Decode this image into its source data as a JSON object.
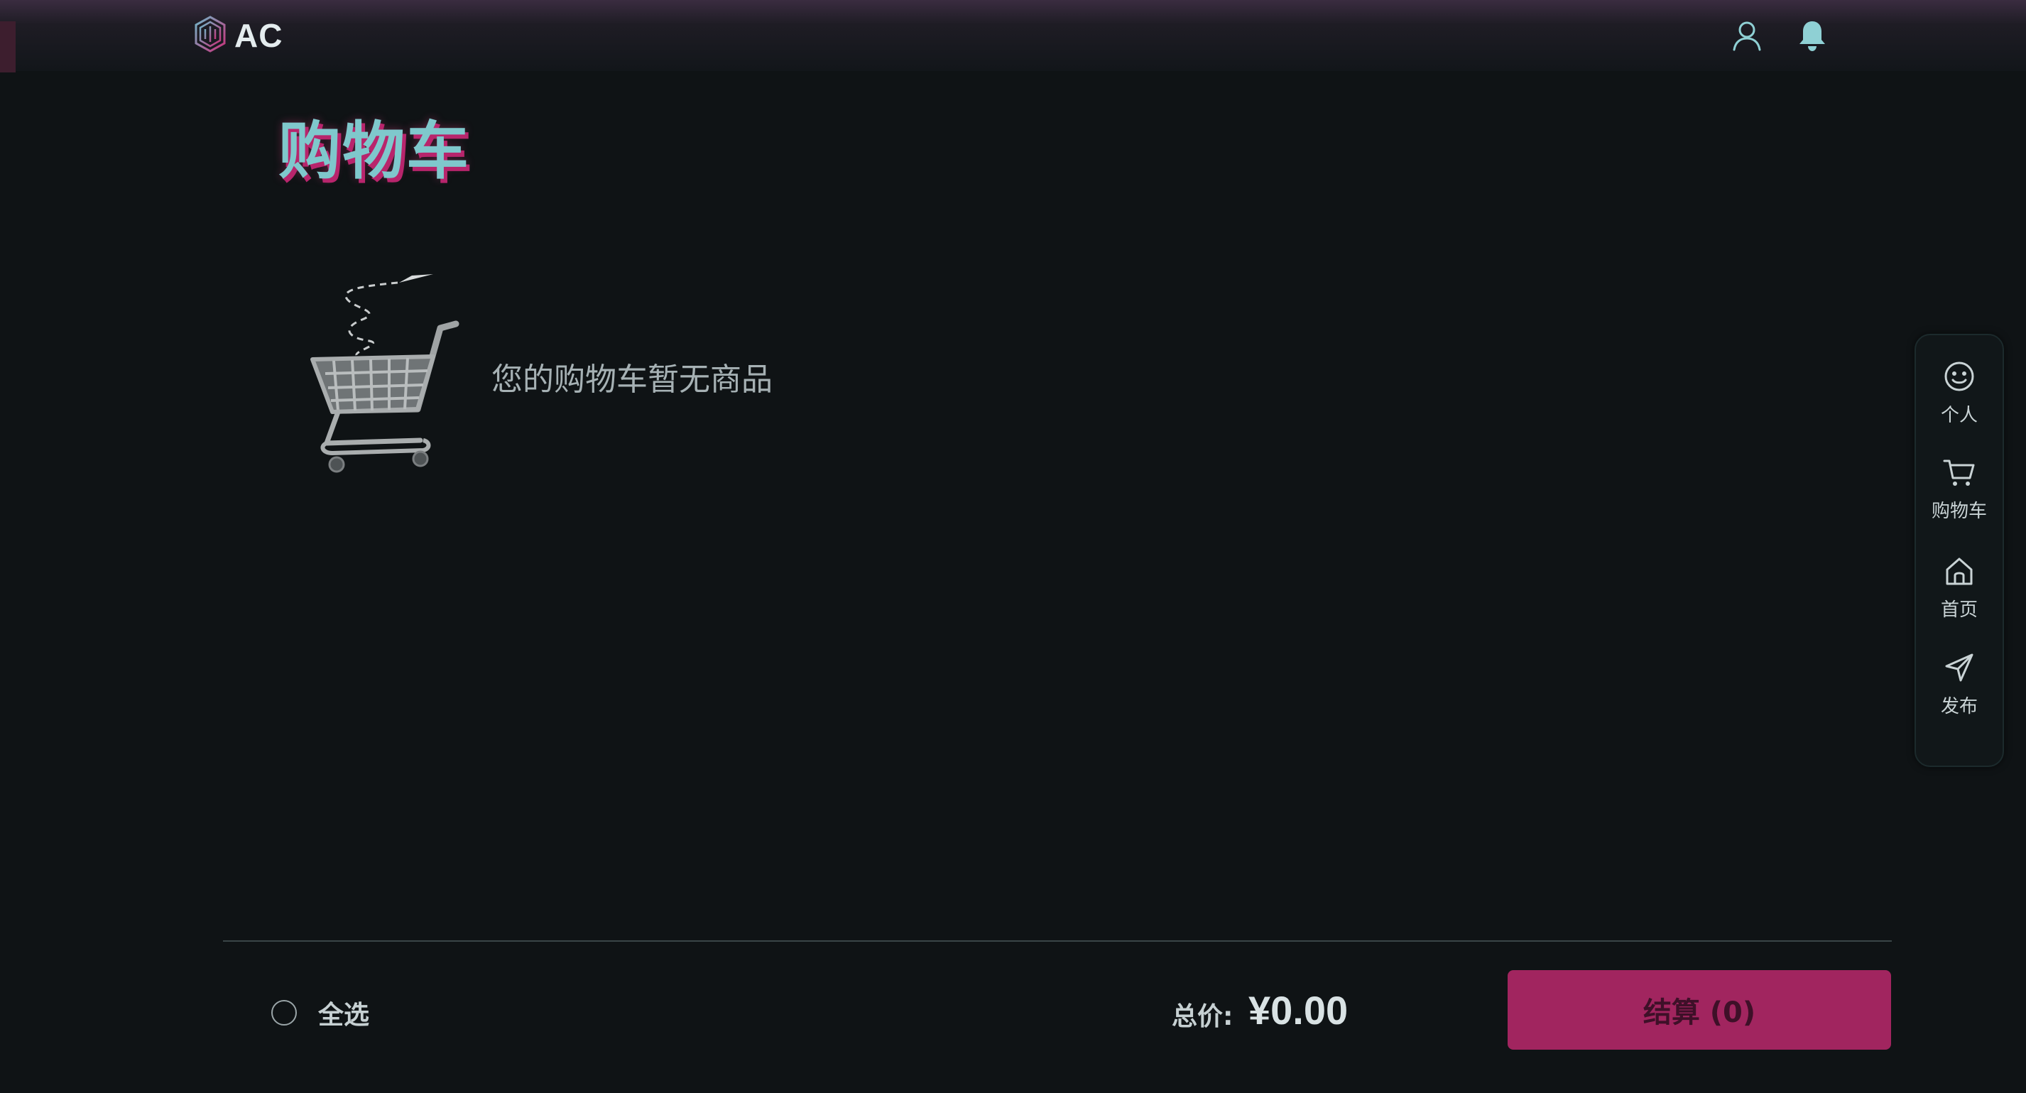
{
  "header": {
    "logo_text": "AC",
    "profile_icon": "user-icon",
    "notification_icon": "bell-icon"
  },
  "page": {
    "title": "购物车",
    "empty_message": "您的购物车暂无商品"
  },
  "sidenav": {
    "items": [
      {
        "label": "个人",
        "icon": "smiley-icon"
      },
      {
        "label": "购物车",
        "icon": "cart-icon"
      },
      {
        "label": "首页",
        "icon": "home-icon"
      },
      {
        "label": "发布",
        "icon": "send-icon"
      }
    ]
  },
  "footer": {
    "select_all_label": "全选",
    "total_label": "总价:",
    "total_value": "¥0.00",
    "checkout_label": "结算 (0)"
  },
  "colors": {
    "background": "#0f1315",
    "accent": "#a1255f",
    "title_teal": "#7fc8cc",
    "title_shadow": "#b8256c"
  }
}
